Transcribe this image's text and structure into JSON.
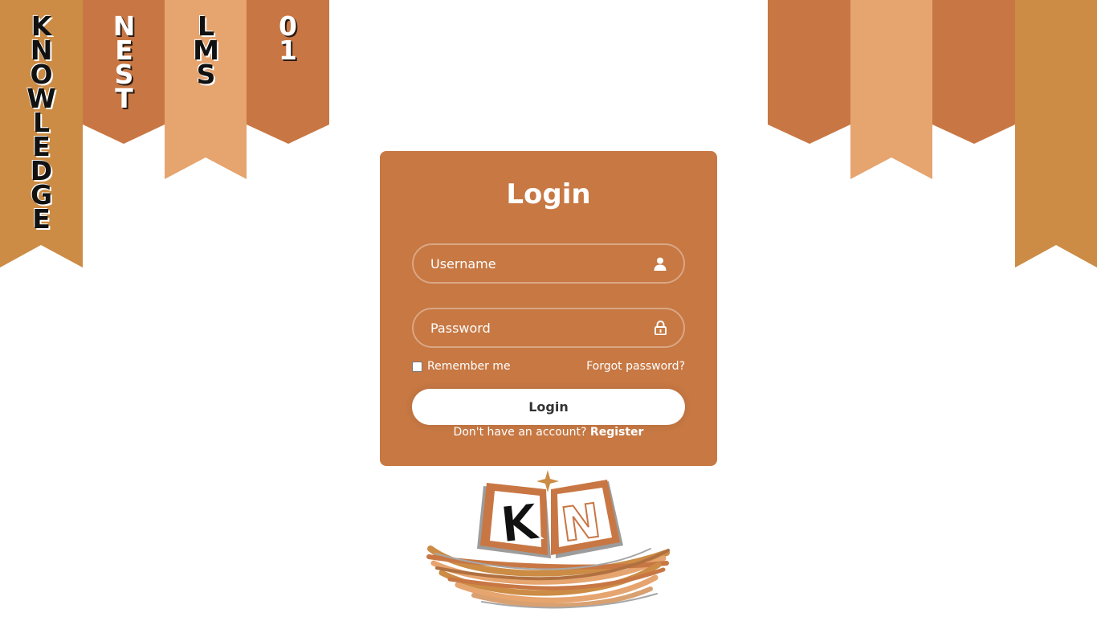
{
  "banner": {
    "word_1": [
      "K",
      "N",
      "O",
      "W",
      "L",
      "E",
      "D",
      "G",
      "E"
    ],
    "word_2": [
      "N",
      "E",
      "S",
      "T"
    ],
    "word_3": [
      "L",
      "M",
      "S"
    ],
    "word_4": [
      "0",
      "1"
    ]
  },
  "colors": {
    "ribbon_gold": "#cc8c45",
    "ribbon_rust": "#c87744",
    "ribbon_peach": "#e6a46f",
    "card_bg": "#c77843"
  },
  "login": {
    "title": "Login",
    "username_placeholder": "Username",
    "username_icon": "user-icon",
    "password_placeholder": "Password",
    "password_icon": "lock-icon",
    "remember_label": "Remember me",
    "forgot_label": "Forgot password?",
    "submit_label": "Login",
    "no_account_text": "Don't have an account?",
    "register_label": "Register"
  },
  "logo": {
    "letters": "KN",
    "name": "knowledge-nest-logo"
  }
}
